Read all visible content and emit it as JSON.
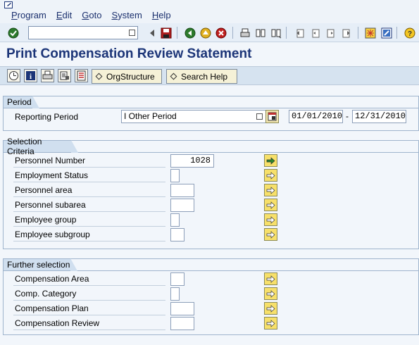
{
  "menu": {
    "items": [
      {
        "label": "Program",
        "accel": "P",
        "rest": "rogram"
      },
      {
        "label": "Edit",
        "accel": "E",
        "rest": "dit"
      },
      {
        "label": "Goto",
        "accel": "G",
        "rest": "oto"
      },
      {
        "label": "System",
        "accel": "S",
        "rest": "ystem"
      },
      {
        "label": "Help",
        "accel": "H",
        "rest": "elp"
      }
    ]
  },
  "toolbar": {
    "command_value": "",
    "icons": [
      "enter-icon",
      "back-arrow-icon",
      "save-icon",
      "back-icon",
      "exit-icon",
      "cancel-icon",
      "print-icon",
      "find-icon",
      "find-next-icon",
      "first-page-icon",
      "previous-page-icon",
      "next-page-icon",
      "last-page-icon",
      "create-session-icon",
      "shortcut-icon",
      "help-icon"
    ]
  },
  "title": "Print Compensation Review Statement",
  "app_toolbar": {
    "icons": [
      "execute-icon",
      "info-icon",
      "print-icon",
      "variant-icon",
      "selection-options-icon"
    ],
    "orgstructure_label": "OrgStructure",
    "search_help_label": "Search Help"
  },
  "period": {
    "title": "Period",
    "reporting_label": "Reporting Period",
    "reporting_value": "I Other Period",
    "from_date": "01/01/2010",
    "date_separator": "-",
    "to_date": "12/31/2010"
  },
  "selection": {
    "title": "Selection Criteria",
    "rows": [
      {
        "label": "Personnel Number",
        "value": "1028"
      },
      {
        "label": "Employment Status",
        "value": ""
      },
      {
        "label": "Personnel area",
        "value": ""
      },
      {
        "label": "Personnel subarea",
        "value": ""
      },
      {
        "label": "Employee group",
        "value": ""
      },
      {
        "label": "Employee subgroup",
        "value": ""
      }
    ]
  },
  "further": {
    "title": "Further selection",
    "rows": [
      {
        "label": "Compensation Area",
        "value": ""
      },
      {
        "label": "Comp. Category",
        "value": ""
      },
      {
        "label": "Compensation Plan",
        "value": ""
      },
      {
        "label": "Compensation Review",
        "value": ""
      }
    ]
  },
  "colors": {
    "title": "#1c3578",
    "menu_text": "#1a2f6d",
    "group_header": "#d0dfef",
    "arrow_button": "#f7e06a",
    "background": "#f2f6fb"
  }
}
